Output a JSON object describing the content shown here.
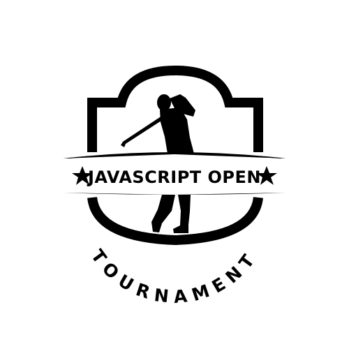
{
  "logo": {
    "title": "JAVASCRIPT OPEN",
    "subtitle": "TOURNAMENT",
    "colors": {
      "background": "#ffffff",
      "ink": "#000000"
    },
    "icons": {
      "left_star": "star-icon",
      "right_star": "star-icon",
      "golfer": "golfer-silhouette-icon"
    }
  }
}
